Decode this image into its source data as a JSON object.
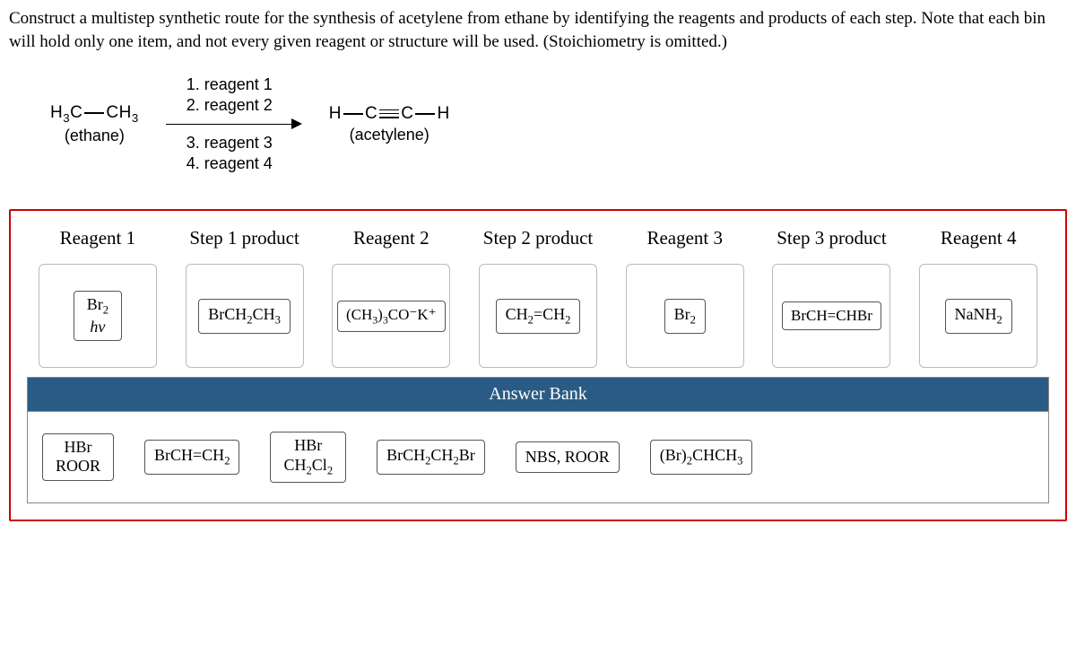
{
  "question": "Construct a multistep synthetic route for the synthesis of acetylene from ethane by identifying the reagents and products of each step. Note that each bin will hold only one item, and not every given reagent or structure will be used. (Stoichiometry is omitted.)",
  "scheme": {
    "start_formula_left": "H",
    "start_formula_c": "C",
    "start_formula_right": "CH",
    "start_formula_sub3a": "3",
    "start_formula_sub3b": "3",
    "start_label": "(ethane)",
    "r1": "1. reagent 1",
    "r2": "2. reagent 2",
    "r3": "3. reagent 3",
    "r4": "4. reagent 4",
    "end_label": "(acetylene)"
  },
  "bins": [
    {
      "label": "Reagent 1",
      "tile": {
        "type": "multi",
        "line1": "Br",
        "sub1": "2",
        "line2": "hv"
      }
    },
    {
      "label": "Step 1 product",
      "tile": {
        "text": "BrCH",
        "sub": "2",
        "tail": "CH",
        "sub2": "3"
      }
    },
    {
      "label": "Reagent 2",
      "tile": {
        "text": "(CH",
        "sub": "3",
        "mid": ")",
        "sub2": "3",
        "tail": "CO⁻K⁺"
      }
    },
    {
      "label": "Step 2 product",
      "tile": {
        "text": "CH",
        "sub": "2",
        "mid": "=CH",
        "sub2": "2"
      }
    },
    {
      "label": "Reagent 3",
      "tile": {
        "text": "Br",
        "sub": "2"
      }
    },
    {
      "label": "Step 3 product",
      "tile": {
        "text": "BrCH=CHBr"
      }
    },
    {
      "label": "Reagent 4",
      "tile": {
        "text": "NaNH",
        "sub": "2"
      }
    }
  ],
  "answerBankLabel": "Answer Bank",
  "answerBank": [
    {
      "type": "multi",
      "line1": "HBr",
      "line2": "ROOR"
    },
    {
      "text": "BrCH=CH",
      "sub": "2"
    },
    {
      "type": "multi",
      "line1": "HBr",
      "line2_a": "CH",
      "line2_sub": "2",
      "line2_b": "Cl",
      "line2_sub2": "2"
    },
    {
      "text": "BrCH",
      "sub": "2",
      "mid": "CH",
      "sub2": "2",
      "tail": "Br"
    },
    {
      "text": "NBS, ROOR"
    },
    {
      "text": "(Br)",
      "sub": "2",
      "tail": "CHCH",
      "sub2": "3"
    }
  ]
}
